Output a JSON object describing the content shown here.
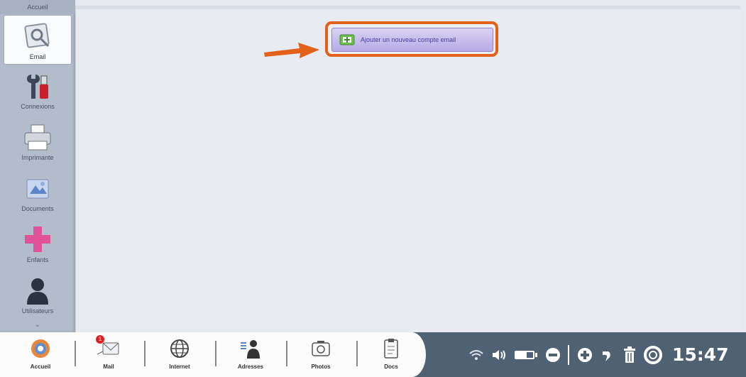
{
  "sidebar": {
    "title": "Accueil",
    "items": [
      {
        "label": "Email",
        "icon": "email-settings-icon",
        "active": true
      },
      {
        "label": "Connexions",
        "icon": "tools-icon",
        "active": false
      },
      {
        "label": "Imprimante",
        "icon": "printer-icon",
        "active": false
      },
      {
        "label": "Documents",
        "icon": "documents-icon",
        "active": false
      },
      {
        "label": "Enfants",
        "icon": "plus-icon",
        "active": false
      },
      {
        "label": "Utilisateurs",
        "icon": "user-icon",
        "active": false
      }
    ]
  },
  "main": {
    "action_button_label": "Ajouter un nouveau compte email",
    "highlight_color": "#e2621a"
  },
  "dock": {
    "items": [
      {
        "label": "Accueil",
        "icon": "home-icon"
      },
      {
        "label": "Mail",
        "icon": "mail-icon",
        "badge": "1"
      },
      {
        "label": "Internet",
        "icon": "globe-icon"
      },
      {
        "label": "Adresses",
        "icon": "address-book-icon"
      },
      {
        "label": "Photos",
        "icon": "camera-icon"
      },
      {
        "label": "Docs",
        "icon": "document-icon"
      }
    ]
  },
  "tray": {
    "clock": "15:47",
    "icons": [
      "wifi-icon",
      "volume-icon",
      "battery-icon",
      "zoom-out-icon",
      "zoom-in-icon",
      "undo-icon",
      "trash-icon",
      "help-icon"
    ]
  },
  "colors": {
    "taskbar": "#4f6273",
    "sidebar": "#b3bccb",
    "accent": "#e2621a"
  }
}
